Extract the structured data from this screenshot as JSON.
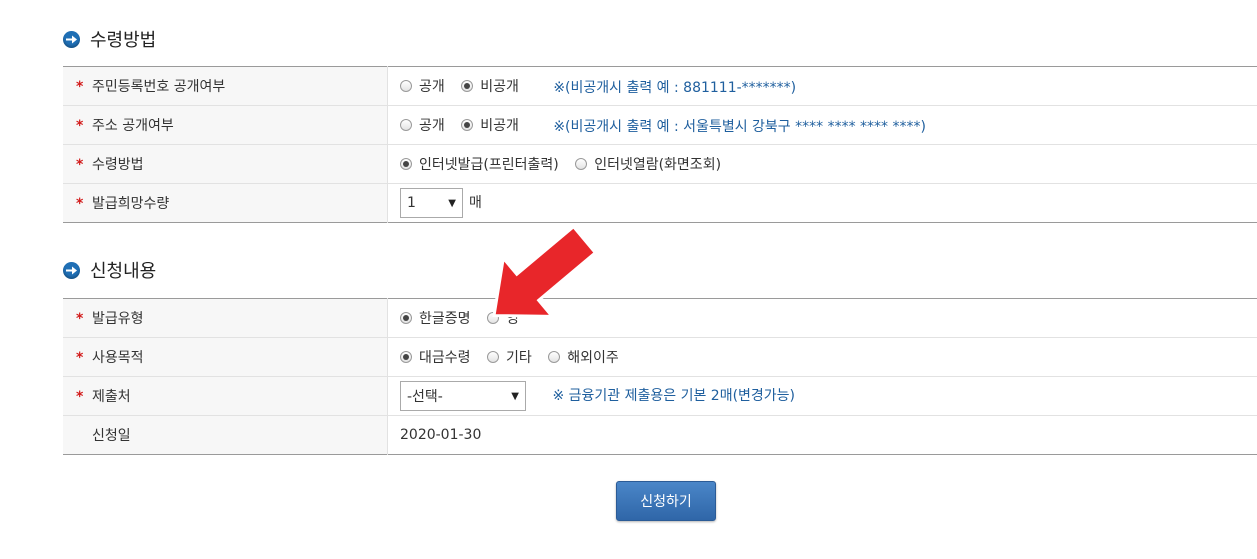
{
  "section1": {
    "title": "수령방법",
    "rows": [
      {
        "label": "주민등록번호 공개여부",
        "options": [
          "공개",
          "비공개"
        ],
        "selected": 1,
        "note": "※(비공개시 출력 예 : 881111-*******)"
      },
      {
        "label": "주소 공개여부",
        "options": [
          "공개",
          "비공개"
        ],
        "selected": 1,
        "note": "※(비공개시 출력 예 : 서울특별시 강북구 **** **** **** ****)"
      },
      {
        "label": "수령방법",
        "options": [
          "인터넷발급(프린터출력)",
          "인터넷열람(화면조회)"
        ],
        "selected": 0
      },
      {
        "label": "발급희망수량",
        "select_value": "1",
        "unit": "매"
      }
    ]
  },
  "section2": {
    "title": "신청내용",
    "rows": [
      {
        "label": "발급유형",
        "options": [
          "한글증명",
          "영"
        ],
        "selected": 0
      },
      {
        "label": "사용목적",
        "options": [
          "대금수령",
          "기타",
          "해외이주"
        ],
        "selected": 0
      },
      {
        "label": "제출처",
        "select_value": "-선택-",
        "note": "※ 금융기관 제출용은 기본 2매(변경가능)"
      },
      {
        "label": "신청일",
        "value": "2020-01-30"
      }
    ]
  },
  "required_mark": "*",
  "submit_label": "신청하기",
  "colors": {
    "accent": "#2f66a8",
    "required": "#d21a1a",
    "note": "#1f5f9e",
    "arrow": "#e8262a"
  }
}
